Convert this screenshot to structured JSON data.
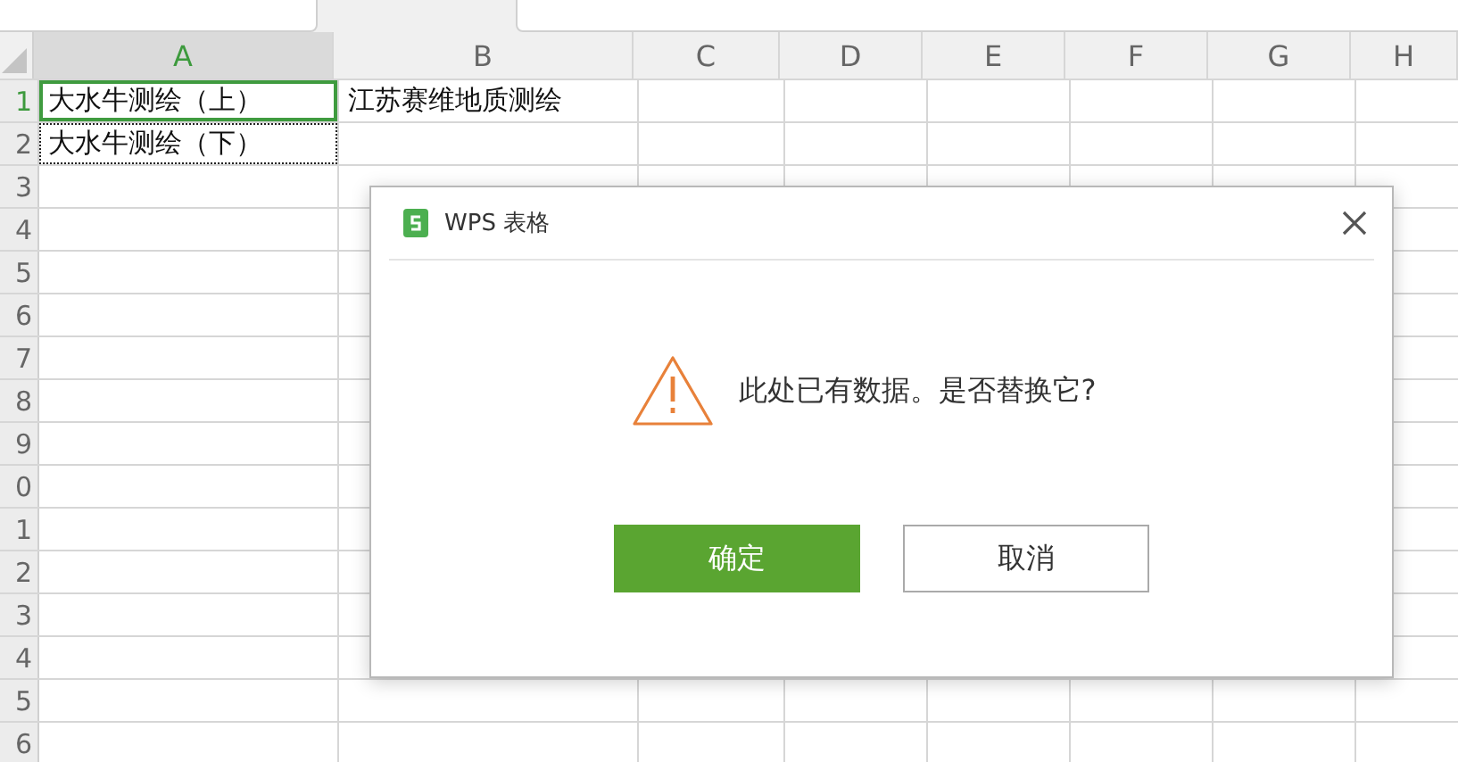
{
  "sheet": {
    "columns": [
      {
        "label": "A",
        "selected": true
      },
      {
        "label": "B",
        "selected": false
      },
      {
        "label": "C",
        "selected": false
      },
      {
        "label": "D",
        "selected": false
      },
      {
        "label": "E",
        "selected": false
      },
      {
        "label": "F",
        "selected": false
      },
      {
        "label": "G",
        "selected": false
      },
      {
        "label": "H",
        "selected": false
      }
    ],
    "rows": [
      {
        "label": "1",
        "selected": true,
        "cells": [
          {
            "text": "大水牛测绘（上）",
            "selected": true,
            "copy_marquee": false
          },
          {
            "text": "江苏赛维地质测绘",
            "selected": false,
            "copy_marquee": false
          }
        ]
      },
      {
        "label": "2",
        "selected": false,
        "cells": [
          {
            "text": "大水牛测绘（下）",
            "selected": false,
            "copy_marquee": true
          }
        ]
      },
      {
        "label": "3",
        "selected": false,
        "cells": []
      },
      {
        "label": "4",
        "selected": false,
        "cells": []
      },
      {
        "label": "5",
        "selected": false,
        "cells": []
      },
      {
        "label": "6",
        "selected": false,
        "cells": []
      },
      {
        "label": "7",
        "selected": false,
        "cells": []
      },
      {
        "label": "8",
        "selected": false,
        "cells": []
      },
      {
        "label": "9",
        "selected": false,
        "cells": []
      },
      {
        "label": "0",
        "selected": false,
        "cells": []
      },
      {
        "label": "1",
        "selected": false,
        "cells": []
      },
      {
        "label": "2",
        "selected": false,
        "cells": []
      },
      {
        "label": "3",
        "selected": false,
        "cells": []
      },
      {
        "label": "4",
        "selected": false,
        "cells": []
      },
      {
        "label": "5",
        "selected": false,
        "cells": []
      },
      {
        "label": "6",
        "selected": false,
        "cells": []
      }
    ]
  },
  "dialog": {
    "title": "WPS 表格",
    "message": "此处已有数据。是否替换它?",
    "buttons": [
      {
        "label": "确定",
        "kind": "primary"
      },
      {
        "label": "取消",
        "kind": "secondary"
      }
    ]
  }
}
